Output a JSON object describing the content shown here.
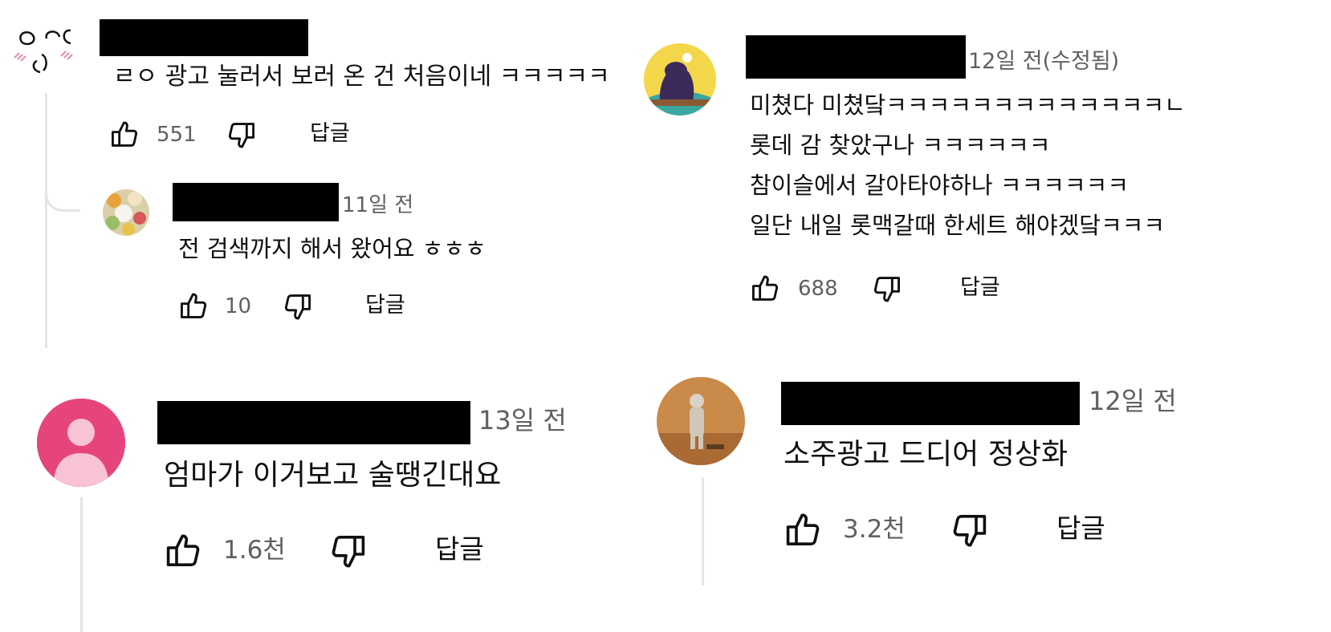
{
  "comments": [
    {
      "id": "c1",
      "lines": [
        "ㄹㅇ 광고 눌러서 보러 온 건 처음이네 ㅋㅋㅋㅋㅋ"
      ],
      "likes": "551",
      "reply_label": "답글",
      "avatar_icon": "doodle-face-avatar",
      "replies": [
        {
          "id": "c1r1",
          "time": "11일 전",
          "lines": [
            "전 검색까지 해서 왔어요 ㅎㅎㅎ"
          ],
          "likes": "10",
          "reply_label": "답글",
          "avatar_icon": "flowers-avatar"
        }
      ]
    },
    {
      "id": "c2",
      "time": "12일 전(수정됨)",
      "lines": [
        "미쳤다  미쳤닼ㅋㅋㅋㅋㅋㅋㅋㅋㅋㅋㅋㅋㅋㄴ",
        "롯데 감 찾았구나 ㅋㅋㅋㅋㅋㅋ",
        "참이슬에서 갈아타야하나 ㅋㅋㅋㅋㅋㅋ",
        "일단 내일 롯맥갈때 한세트 해야겠닼ㅋㅋㅋ"
      ],
      "likes": "688",
      "reply_label": "답글",
      "avatar_icon": "panther-avatar"
    },
    {
      "id": "c3",
      "time": "13일 전",
      "lines": [
        "엄마가 이거보고 술땡긴대요"
      ],
      "likes": "1.6천",
      "reply_label": "답글",
      "avatar_icon": "default-user-avatar",
      "avatar_color": "#e5457c"
    },
    {
      "id": "c4",
      "time": "12일 전",
      "lines": [
        "소주광고 드디어 정상화"
      ],
      "likes": "3.2천",
      "reply_label": "답글",
      "avatar_icon": "astronaut-avatar"
    }
  ],
  "icons": {
    "like": "thumbs-up-icon",
    "dislike": "thumbs-down-icon"
  },
  "colors": {
    "text": "#0f0f0f",
    "meta": "#606060",
    "redaction": "#000000",
    "thread_line": "#e5e5e5"
  }
}
